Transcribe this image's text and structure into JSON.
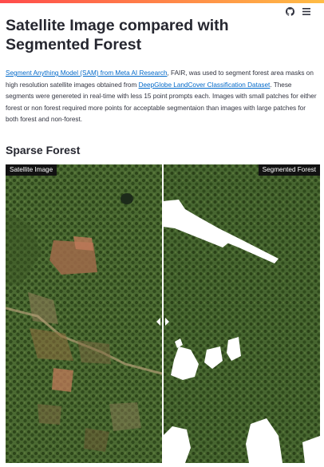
{
  "app": {
    "github_icon": "github-icon",
    "menu_icon": "hamburger-menu-icon",
    "accent": "#ff4b4b",
    "link_color": "#0068c9"
  },
  "page": {
    "title": "Satellite Image compared with Segmented Forest",
    "intro": {
      "link1": "Segment Anything Model (SAM) from Meta AI Research",
      "text1": ", FAIR, was used to segment forest area masks on high resolution satellite images obtained from ",
      "link2": "DeepGlobe LandCover Classification Dataset",
      "text2": ". These segments were genereted in real-time with less 15 point prompts each. Images with small patches for either forest or non forest required more points for acceptable segmentaion than images with large patches for both forest and non-forest."
    },
    "section_title": "Sparse Forest"
  },
  "comparison": {
    "left_label": "Satellite Image",
    "right_label": "Segmented Forest",
    "slider_percent": 50,
    "mask_color": "#ffffff"
  }
}
